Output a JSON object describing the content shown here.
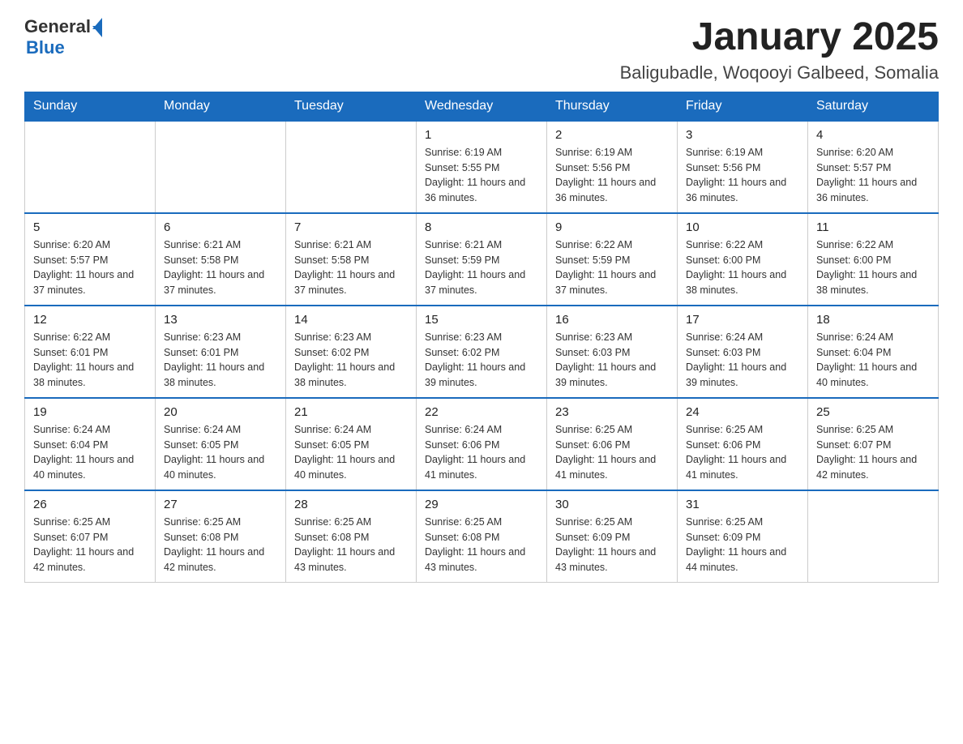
{
  "logo": {
    "general": "General",
    "blue": "Blue"
  },
  "title": "January 2025",
  "subtitle": "Baligubadle, Woqooyi Galbeed, Somalia",
  "headers": [
    "Sunday",
    "Monday",
    "Tuesday",
    "Wednesday",
    "Thursday",
    "Friday",
    "Saturday"
  ],
  "weeks": [
    [
      {
        "day": "",
        "info": ""
      },
      {
        "day": "",
        "info": ""
      },
      {
        "day": "",
        "info": ""
      },
      {
        "day": "1",
        "info": "Sunrise: 6:19 AM\nSunset: 5:55 PM\nDaylight: 11 hours and 36 minutes."
      },
      {
        "day": "2",
        "info": "Sunrise: 6:19 AM\nSunset: 5:56 PM\nDaylight: 11 hours and 36 minutes."
      },
      {
        "day": "3",
        "info": "Sunrise: 6:19 AM\nSunset: 5:56 PM\nDaylight: 11 hours and 36 minutes."
      },
      {
        "day": "4",
        "info": "Sunrise: 6:20 AM\nSunset: 5:57 PM\nDaylight: 11 hours and 36 minutes."
      }
    ],
    [
      {
        "day": "5",
        "info": "Sunrise: 6:20 AM\nSunset: 5:57 PM\nDaylight: 11 hours and 37 minutes."
      },
      {
        "day": "6",
        "info": "Sunrise: 6:21 AM\nSunset: 5:58 PM\nDaylight: 11 hours and 37 minutes."
      },
      {
        "day": "7",
        "info": "Sunrise: 6:21 AM\nSunset: 5:58 PM\nDaylight: 11 hours and 37 minutes."
      },
      {
        "day": "8",
        "info": "Sunrise: 6:21 AM\nSunset: 5:59 PM\nDaylight: 11 hours and 37 minutes."
      },
      {
        "day": "9",
        "info": "Sunrise: 6:22 AM\nSunset: 5:59 PM\nDaylight: 11 hours and 37 minutes."
      },
      {
        "day": "10",
        "info": "Sunrise: 6:22 AM\nSunset: 6:00 PM\nDaylight: 11 hours and 38 minutes."
      },
      {
        "day": "11",
        "info": "Sunrise: 6:22 AM\nSunset: 6:00 PM\nDaylight: 11 hours and 38 minutes."
      }
    ],
    [
      {
        "day": "12",
        "info": "Sunrise: 6:22 AM\nSunset: 6:01 PM\nDaylight: 11 hours and 38 minutes."
      },
      {
        "day": "13",
        "info": "Sunrise: 6:23 AM\nSunset: 6:01 PM\nDaylight: 11 hours and 38 minutes."
      },
      {
        "day": "14",
        "info": "Sunrise: 6:23 AM\nSunset: 6:02 PM\nDaylight: 11 hours and 38 minutes."
      },
      {
        "day": "15",
        "info": "Sunrise: 6:23 AM\nSunset: 6:02 PM\nDaylight: 11 hours and 39 minutes."
      },
      {
        "day": "16",
        "info": "Sunrise: 6:23 AM\nSunset: 6:03 PM\nDaylight: 11 hours and 39 minutes."
      },
      {
        "day": "17",
        "info": "Sunrise: 6:24 AM\nSunset: 6:03 PM\nDaylight: 11 hours and 39 minutes."
      },
      {
        "day": "18",
        "info": "Sunrise: 6:24 AM\nSunset: 6:04 PM\nDaylight: 11 hours and 40 minutes."
      }
    ],
    [
      {
        "day": "19",
        "info": "Sunrise: 6:24 AM\nSunset: 6:04 PM\nDaylight: 11 hours and 40 minutes."
      },
      {
        "day": "20",
        "info": "Sunrise: 6:24 AM\nSunset: 6:05 PM\nDaylight: 11 hours and 40 minutes."
      },
      {
        "day": "21",
        "info": "Sunrise: 6:24 AM\nSunset: 6:05 PM\nDaylight: 11 hours and 40 minutes."
      },
      {
        "day": "22",
        "info": "Sunrise: 6:24 AM\nSunset: 6:06 PM\nDaylight: 11 hours and 41 minutes."
      },
      {
        "day": "23",
        "info": "Sunrise: 6:25 AM\nSunset: 6:06 PM\nDaylight: 11 hours and 41 minutes."
      },
      {
        "day": "24",
        "info": "Sunrise: 6:25 AM\nSunset: 6:06 PM\nDaylight: 11 hours and 41 minutes."
      },
      {
        "day": "25",
        "info": "Sunrise: 6:25 AM\nSunset: 6:07 PM\nDaylight: 11 hours and 42 minutes."
      }
    ],
    [
      {
        "day": "26",
        "info": "Sunrise: 6:25 AM\nSunset: 6:07 PM\nDaylight: 11 hours and 42 minutes."
      },
      {
        "day": "27",
        "info": "Sunrise: 6:25 AM\nSunset: 6:08 PM\nDaylight: 11 hours and 42 minutes."
      },
      {
        "day": "28",
        "info": "Sunrise: 6:25 AM\nSunset: 6:08 PM\nDaylight: 11 hours and 43 minutes."
      },
      {
        "day": "29",
        "info": "Sunrise: 6:25 AM\nSunset: 6:08 PM\nDaylight: 11 hours and 43 minutes."
      },
      {
        "day": "30",
        "info": "Sunrise: 6:25 AM\nSunset: 6:09 PM\nDaylight: 11 hours and 43 minutes."
      },
      {
        "day": "31",
        "info": "Sunrise: 6:25 AM\nSunset: 6:09 PM\nDaylight: 11 hours and 44 minutes."
      },
      {
        "day": "",
        "info": ""
      }
    ]
  ]
}
